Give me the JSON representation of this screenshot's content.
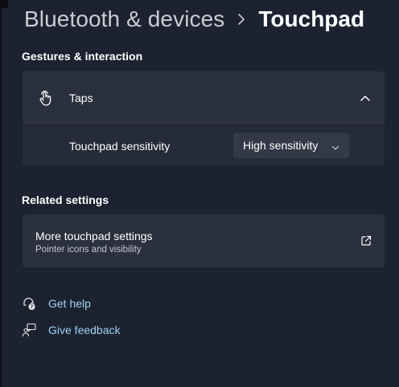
{
  "breadcrumb": {
    "parent": "Bluetooth & devices",
    "separator_icon": "chevron-right-icon",
    "current": "Touchpad"
  },
  "gestures_section": {
    "title": "Gestures & interaction",
    "taps": {
      "icon": "tap-hand-icon",
      "label": "Taps",
      "expanded": true,
      "sensitivity": {
        "label": "Touchpad sensitivity",
        "selected": "High sensitivity"
      }
    }
  },
  "related_section": {
    "title": "Related settings",
    "more": {
      "title": "More touchpad settings",
      "subtitle": "Pointer icons and visibility",
      "icon": "external-link-icon"
    }
  },
  "help_links": [
    {
      "label": "Get help",
      "icon": "help-icon"
    },
    {
      "label": "Give feedback",
      "icon": "feedback-icon"
    }
  ],
  "colors": {
    "background": "#1c2230",
    "card": "#252b39",
    "link": "#9fd3f5"
  }
}
